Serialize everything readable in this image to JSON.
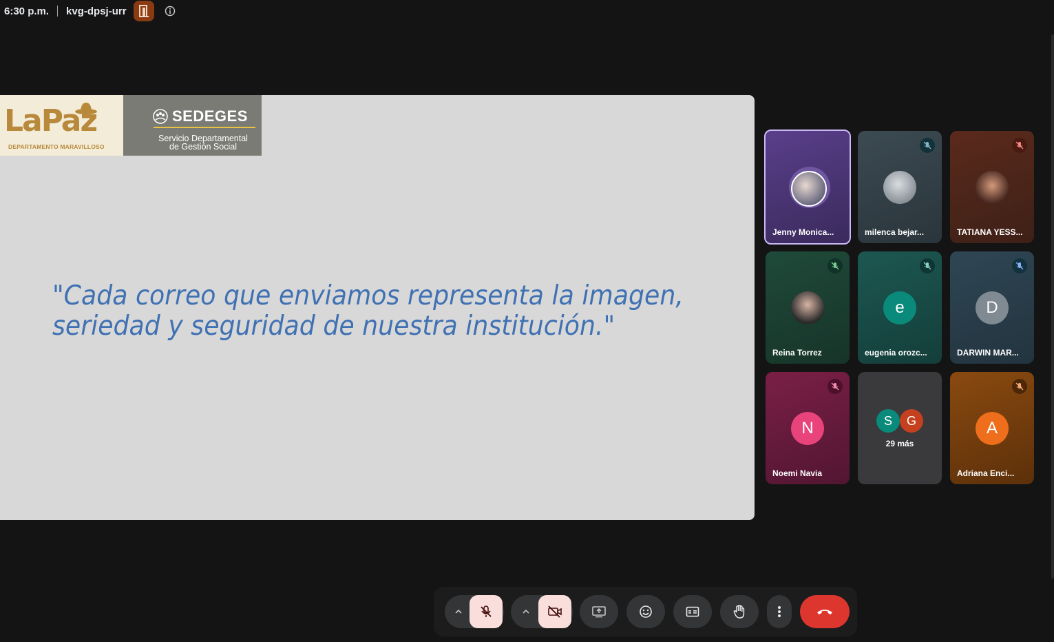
{
  "topbar": {
    "time": "6:30 p.m.",
    "meeting_code": "kvg-dpsj-urr",
    "room_icon": "door-icon",
    "info_icon": "info-icon"
  },
  "slide": {
    "logo_lapaz_word": "LaPaz",
    "logo_lapaz_sub": "DEPARTAMENTO MARAVILLOSO",
    "logo_sedeges_word": "SEDEGES",
    "logo_sedeges_sub1": "Servicio Departamental",
    "logo_sedeges_sub2": "de Gestión Social",
    "quote_line1": "\"Cada correo que enviamos representa la imagen,",
    "quote_line2": "seriedad y seguridad de nuestra institución.\""
  },
  "participants": [
    {
      "name": "Jenny Monica...",
      "type": "photo",
      "muted": false
    },
    {
      "name": "milenca bejar...",
      "type": "photo",
      "muted": true
    },
    {
      "name": "TATIANA YESS...",
      "type": "photo",
      "muted": true
    },
    {
      "name": "Reina Torrez",
      "type": "photo",
      "muted": true
    },
    {
      "name": "eugenia orozc...",
      "type": "initial",
      "initial": "e",
      "muted": true
    },
    {
      "name": "DARWIN MAR...",
      "type": "initial",
      "initial": "D",
      "muted": true
    },
    {
      "name": "Noemi Navia",
      "type": "initial",
      "initial": "N",
      "muted": true
    },
    {
      "name": "",
      "type": "more",
      "initials": [
        "S",
        "G"
      ],
      "more_label": "29 más"
    },
    {
      "name": "Adriana Enci...",
      "type": "initial",
      "initial": "A",
      "muted": true
    }
  ],
  "colors": {
    "background": "#141414",
    "slide_bg": "#d8d8d8",
    "quote_text": "#3f71b3",
    "active_border": "#c9b8f5",
    "leave_button": "#dc362e",
    "muted_pill": "#f9dedc"
  },
  "controls": {
    "mic_options_icon": "chevron-up-icon",
    "mic_icon": "mic-off-icon",
    "camera_options_icon": "chevron-up-icon",
    "camera_icon": "camera-off-icon",
    "present_icon": "present-screen-icon",
    "emoji_icon": "emoji-icon",
    "captions_icon": "captions-icon",
    "raise_hand_icon": "hand-icon",
    "more_icon": "more-vert-icon",
    "leave_icon": "hang-up-icon"
  }
}
